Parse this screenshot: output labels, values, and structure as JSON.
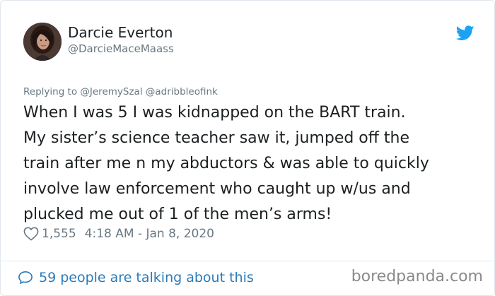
{
  "author": {
    "display_name": "Darcie Everton",
    "handle": "@DarcieMaceMaass",
    "avatar_icon": "avatar-photo"
  },
  "platform_icon": "twitter-bird-icon",
  "reply": {
    "text": "Replying to @JeremySzal @adribbleofink"
  },
  "tweet": {
    "text": "When I was 5 I was kidnapped on the BART train.\nMy sister’s science teacher saw it, jumped off the\ntrain after me n my abductors & was able to quickly\ninvolve law enforcement who caught up w/us and\nplucked me out of 1 of the men’s arms!"
  },
  "meta": {
    "likes": "1,555",
    "timestamp": "4:18 AM - Jan 8, 2020"
  },
  "footer": {
    "talking_text": "59 people are talking about this",
    "watermark": "boredpanda.com"
  },
  "colors": {
    "link_blue": "#2b7bb9",
    "twitter_blue": "#1da1f2",
    "muted_gray": "#697882",
    "text_dark": "#1c2022",
    "border": "#e1e8ed"
  }
}
